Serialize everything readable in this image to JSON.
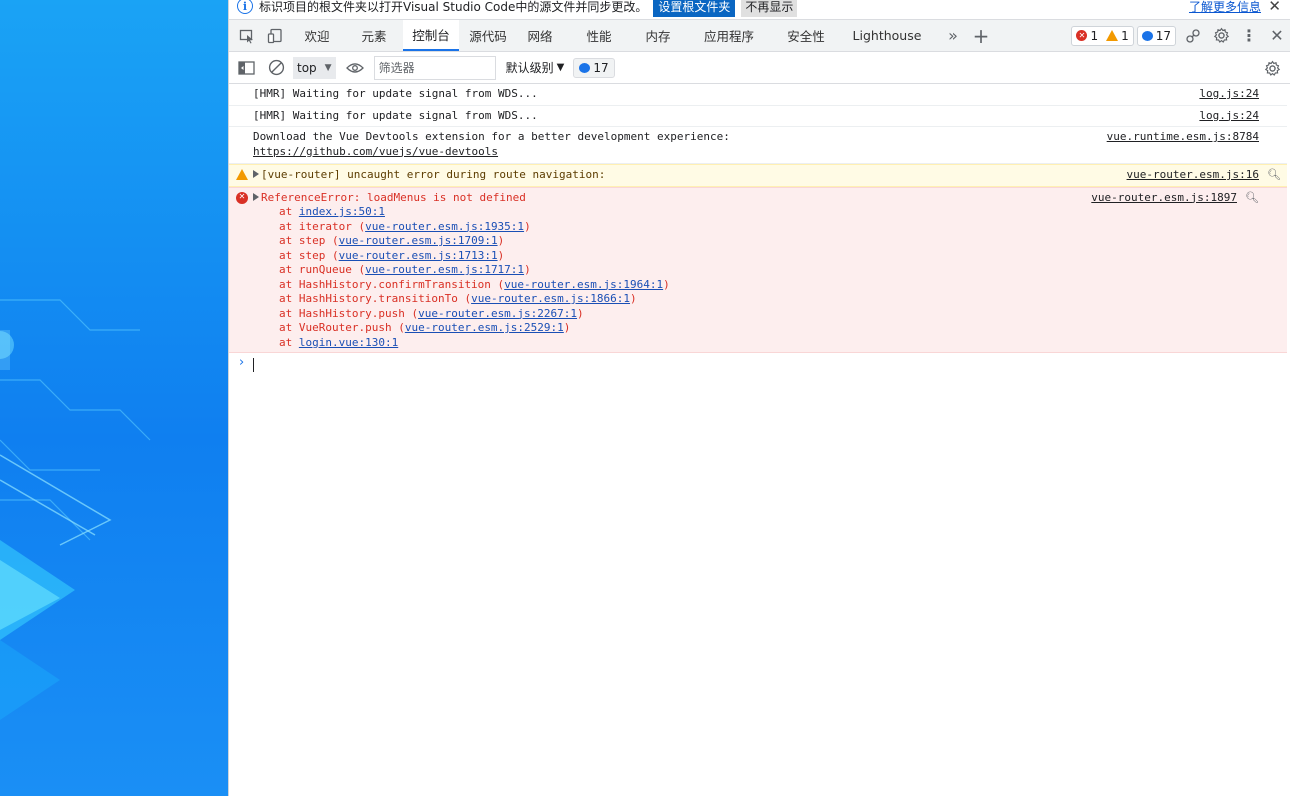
{
  "infobar": {
    "message": "标识项目的根文件夹以打开Visual Studio Code中的源文件并同步更改。",
    "primary_button": "设置根文件夹",
    "secondary_button": "不再显示",
    "learn_more": "了解更多信息"
  },
  "tabs": [
    {
      "label": "欢迎"
    },
    {
      "label": "元素"
    },
    {
      "label": "控制台",
      "active": true
    },
    {
      "label": "源代码"
    },
    {
      "label": "网络"
    },
    {
      "label": "性能"
    },
    {
      "label": "内存"
    },
    {
      "label": "应用程序"
    },
    {
      "label": "安全性"
    },
    {
      "label": "Lighthouse"
    }
  ],
  "counts": {
    "errors": "1",
    "warnings": "1",
    "issues": "17"
  },
  "toolbar": {
    "context": "top",
    "filter_placeholder": "筛选器",
    "levels": "默认级别",
    "issues_count": "17"
  },
  "messages": [
    {
      "level": "log",
      "text": "[HMR] Waiting for update signal from WDS...",
      "source": "log.js:24"
    },
    {
      "level": "log",
      "text": "[HMR] Waiting for update signal from WDS...",
      "source": "log.js:24"
    },
    {
      "level": "log",
      "text": "Download the Vue Devtools extension for a better development experience:",
      "link": "https://github.com/vuejs/vue-devtools",
      "source": "vue.runtime.esm.js:8784"
    },
    {
      "level": "warning",
      "text": "[vue-router] uncaught error during route navigation:",
      "source": "vue-router.esm.js:16"
    },
    {
      "level": "error",
      "text": "ReferenceError: loadMenus is not defined",
      "source": "vue-router.esm.js:1897",
      "stack": [
        {
          "prefix": "at ",
          "fn": "",
          "loc": "index.js:50:1"
        },
        {
          "prefix": "at ",
          "fn": "iterator",
          "loc": "vue-router.esm.js:1935:1"
        },
        {
          "prefix": "at ",
          "fn": "step",
          "loc": "vue-router.esm.js:1709:1"
        },
        {
          "prefix": "at ",
          "fn": "step",
          "loc": "vue-router.esm.js:1713:1"
        },
        {
          "prefix": "at ",
          "fn": "runQueue",
          "loc": "vue-router.esm.js:1717:1"
        },
        {
          "prefix": "at ",
          "fn": "HashHistory.confirmTransition",
          "loc": "vue-router.esm.js:1964:1"
        },
        {
          "prefix": "at ",
          "fn": "HashHistory.transitionTo",
          "loc": "vue-router.esm.js:1866:1"
        },
        {
          "prefix": "at ",
          "fn": "HashHistory.push",
          "loc": "vue-router.esm.js:2267:1"
        },
        {
          "prefix": "at ",
          "fn": "VueRouter.push",
          "loc": "vue-router.esm.js:2529:1"
        },
        {
          "prefix": "at ",
          "fn": "",
          "loc": "login.vue:130:1"
        }
      ]
    }
  ],
  "colors": {
    "accent": "#1a73e8",
    "error": "#d93025",
    "warning": "#f29900",
    "page_bg": "#0f7ff0"
  }
}
